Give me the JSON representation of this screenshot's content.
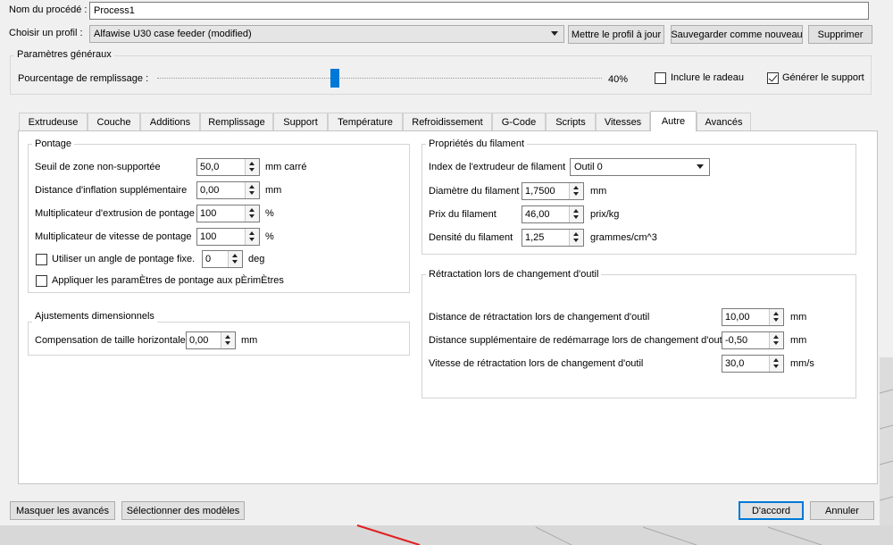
{
  "process": {
    "label": "Nom du procédé :",
    "value": "Process1"
  },
  "profile": {
    "label": "Choisir un profil :",
    "selected": "Alfawise U30 case feeder (modified)",
    "update_button": "Mettre le profil à jour",
    "save_new_button": "Sauvegarder comme nouveau",
    "delete_button": "Supprimer"
  },
  "general": {
    "title": "Paramètres généraux",
    "infill_label": "Pourcentage de remplissage :",
    "infill_value": "40%",
    "infill_fraction": 0.4,
    "raft_label": "Inclure le radeau",
    "raft_checked": false,
    "support_label": "Générer le support",
    "support_checked": true
  },
  "tabs": [
    {
      "label": "Extrudeuse"
    },
    {
      "label": "Couche"
    },
    {
      "label": "Additions"
    },
    {
      "label": "Remplissage"
    },
    {
      "label": "Support"
    },
    {
      "label": "Température"
    },
    {
      "label": "Refroidissement"
    },
    {
      "label": "G-Code"
    },
    {
      "label": "Scripts"
    },
    {
      "label": "Vitesses"
    },
    {
      "label": "Autre",
      "active": true
    },
    {
      "label": "Avancés"
    }
  ],
  "bridging": {
    "title": "Pontage",
    "rows": [
      {
        "label": "Seuil de zone non-supportée",
        "value": "50,0",
        "unit": "mm carré"
      },
      {
        "label": "Distance d'inflation supplémentaire",
        "value": "0,00",
        "unit": "mm"
      },
      {
        "label": "Multiplicateur d'extrusion de pontage",
        "value": "100",
        "unit": "%"
      },
      {
        "label": "Multiplicateur de vitesse de pontage",
        "value": "100",
        "unit": "%"
      }
    ],
    "fixed_angle_label": "Utiliser un angle de pontage fixe.",
    "fixed_angle_value": "0",
    "fixed_angle_unit": "deg",
    "apply_perimeters_label": "Appliquer les paramÈtres de pontage aux pÈrimÈtres"
  },
  "dimensional": {
    "title": "Ajustements dimensionnels",
    "label": "Compensation de taille horizontale",
    "value": "0,00",
    "unit": "mm"
  },
  "filament": {
    "title": "Propriétés du filament",
    "extruder_label": "Index de l'extrudeur de filament",
    "extruder_value": "Outil 0",
    "rows": [
      {
        "label": "Diamètre du filament",
        "value": "1,7500",
        "unit": "mm"
      },
      {
        "label": "Prix du filament",
        "value": "46,00",
        "unit": "prix/kg"
      },
      {
        "label": "Densité du filament",
        "value": "1,25",
        "unit": "grammes/cm^3"
      }
    ]
  },
  "toolchange": {
    "title": "Rétractation lors de changement d'outil",
    "rows": [
      {
        "label": "Distance de rétractation lors de changement d'outil",
        "value": "10,00",
        "unit": "mm"
      },
      {
        "label": "Distance supplémentaire de redémarrage lors de changement d'outil",
        "value": "-0,50",
        "unit": "mm"
      },
      {
        "label": "Vitesse de rétractation lors de changement d'outil",
        "value": "30,0",
        "unit": "mm/s"
      }
    ]
  },
  "footer": {
    "hide_advanced": "Masquer les avancés",
    "select_models": "Sélectionner des modèles",
    "ok": "D'accord",
    "cancel": "Annuler"
  }
}
